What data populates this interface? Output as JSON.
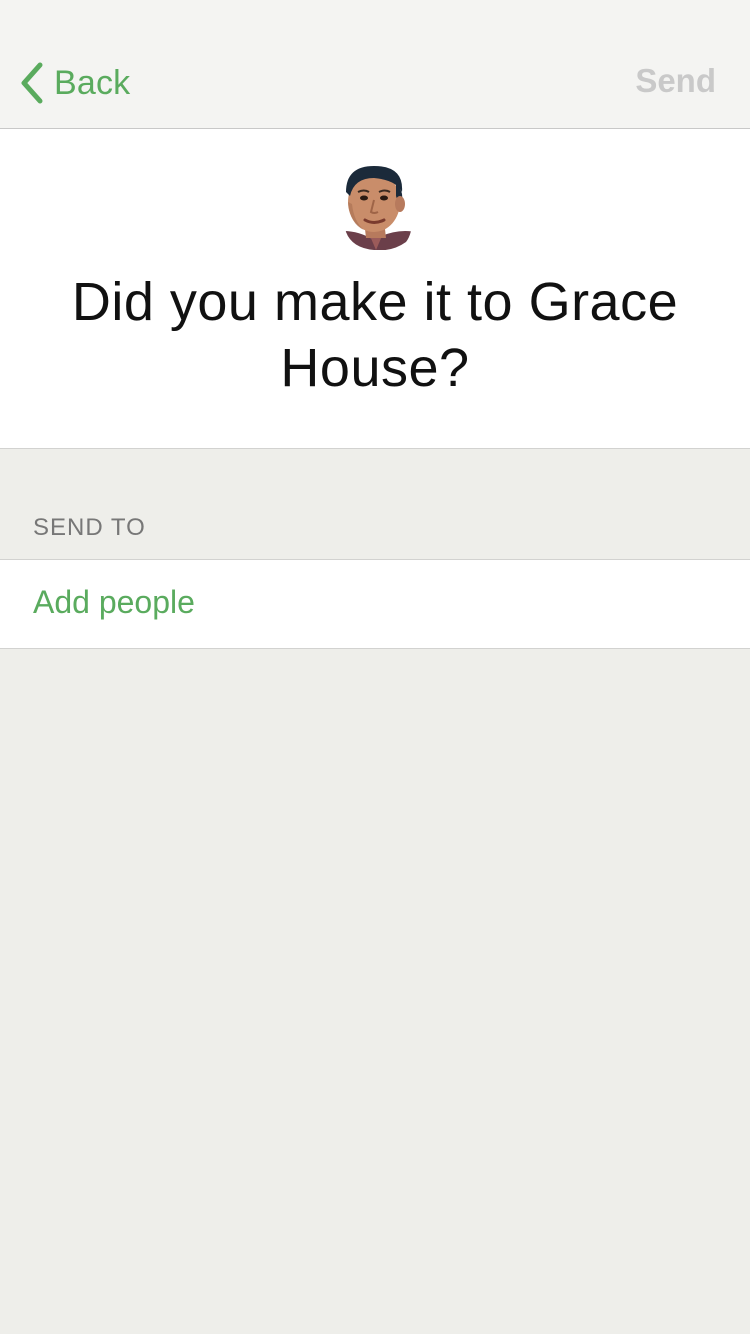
{
  "navbar": {
    "back_label": "Back",
    "send_label": "Send",
    "back_icon": "chevron-left-icon",
    "accent_color": "#5aab5e",
    "send_disabled_color": "#c9c9c9"
  },
  "header": {
    "avatar": "avatar-photo",
    "question": "Did you make it to Grace House?"
  },
  "send_to": {
    "section_label": "SEND TO",
    "add_label": "Add people"
  }
}
